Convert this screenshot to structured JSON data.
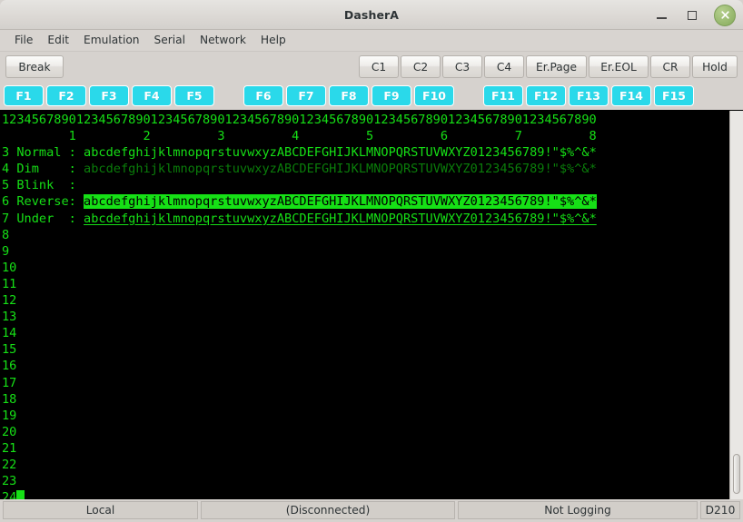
{
  "window": {
    "title": "DasherA",
    "controls": {
      "minimize": "minimize-icon",
      "maximize": "maximize-icon",
      "close": "close-icon"
    }
  },
  "menubar": {
    "items": [
      "File",
      "Edit",
      "Emulation",
      "Serial",
      "Network",
      "Help"
    ]
  },
  "toolbar": {
    "left": [
      "Break"
    ],
    "right": [
      "C1",
      "C2",
      "C3",
      "C4",
      "Er.Page",
      "Er.EOL",
      "CR",
      "Hold"
    ]
  },
  "function_keys": {
    "group1": [
      "F1",
      "F2",
      "F3",
      "F4",
      "F5"
    ],
    "group2": [
      "F6",
      "F7",
      "F8",
      "F9",
      "F10"
    ],
    "group3": [
      "F11",
      "F12",
      "F13",
      "F14",
      "F15"
    ]
  },
  "terminal": {
    "colors": {
      "background": "#000000",
      "foreground": "#16e016",
      "dim": "#0a7d0a",
      "reverse_bg": "#16e016",
      "reverse_fg": "#000000"
    },
    "columns": 80,
    "rows": 24,
    "ruler_digits": "12345678901234567890123456789012345678901234567890123456789012345678901234567890",
    "ruler_tens": "         1         2         3         4         5         6         7         8",
    "sample_text": "abcdefghijklmnopqrstuvwxyzABCDEFGHIJKLMNOPQRSTUVWXYZ0123456789!\"$%^&*",
    "attribute_lines": [
      {
        "line_no": "3",
        "label": "Normal ",
        "colon": ":",
        "style": "normal"
      },
      {
        "line_no": "4",
        "label": "Dim    ",
        "colon": ":",
        "style": "dim"
      },
      {
        "line_no": "5",
        "label": "Blink  ",
        "colon": ":",
        "style": "blink"
      },
      {
        "line_no": "6",
        "label": "Reverse",
        "colon": ":",
        "style": "reverse"
      },
      {
        "line_no": "7",
        "label": "Under  ",
        "colon": ":",
        "style": "under"
      }
    ],
    "blank_line_numbers": [
      "8",
      "9",
      "10",
      "11",
      "12",
      "13",
      "14",
      "15",
      "16",
      "17",
      "18",
      "19",
      "20",
      "21",
      "22",
      "23"
    ],
    "cursor_line_number": "24"
  },
  "statusbar": {
    "connection_mode": "Local",
    "connection_state": "(Disconnected)",
    "logging_state": "Not Logging",
    "emulation": "D210"
  }
}
